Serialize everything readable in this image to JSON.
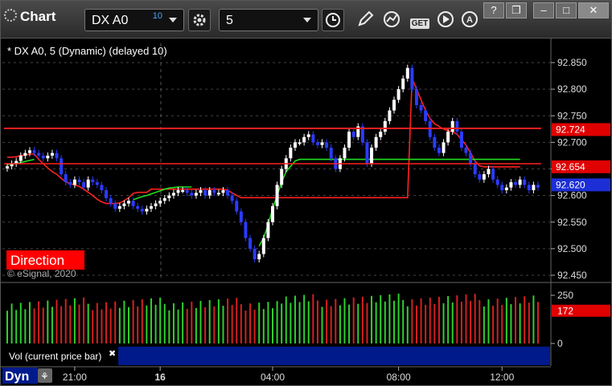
{
  "window": {
    "title": "Chart"
  },
  "toolbar": {
    "symbol": "DX A0",
    "symbol_delay": "10",
    "interval": "5",
    "get_label": "GET",
    "win_help": "?",
    "win_restore": "❐",
    "win_min": "–",
    "win_max": "□",
    "win_close": "✕"
  },
  "chart_header": "* DX A0, 5 (Dynamic) (delayed 10)",
  "direction_label": "Direction",
  "copyright": "© eSignal, 2020",
  "volume_label": "Vol (current price bar)",
  "volume_close": "✖",
  "bottom": {
    "scroll_label": "Dyn"
  },
  "colors": {
    "up_bar": "#ffffff",
    "down_bar": "#2b3bff",
    "red_line": "#ff2020",
    "green_line": "#22dd22",
    "price_tag_blue": "#1c2fd6"
  },
  "chart_data": [
    {
      "type": "candlestick",
      "ylim": [
        92.44,
        92.87
      ],
      "ytick_labels": [
        "92.850",
        "92.800",
        "92.750",
        "92.700",
        "92.650",
        "92.600",
        "92.550",
        "92.500",
        "92.450"
      ],
      "yticks": [
        92.85,
        92.8,
        92.75,
        92.7,
        92.65,
        92.6,
        92.55,
        92.5,
        92.45
      ],
      "xtick_labels": [
        "21:00",
        "16",
        "04:00",
        "08:00",
        "12:00"
      ],
      "xtick_index": [
        15,
        34,
        59,
        87,
        110
      ],
      "price_tags": [
        {
          "label": "92.724",
          "value": 92.724,
          "kind": "red"
        },
        {
          "label": "92.654",
          "value": 92.654,
          "kind": "red"
        },
        {
          "label": "92.620",
          "value": 92.62,
          "kind": "blue"
        }
      ],
      "close": [
        92.655,
        92.66,
        92.665,
        92.675,
        92.68,
        92.685,
        92.68,
        92.675,
        92.67,
        92.675,
        92.68,
        92.67,
        92.64,
        92.625,
        92.62,
        92.63,
        92.625,
        92.615,
        92.63,
        92.625,
        92.62,
        92.61,
        92.595,
        92.585,
        92.575,
        92.58,
        92.585,
        92.59,
        92.58,
        92.575,
        92.57,
        92.575,
        92.58,
        92.585,
        92.59,
        92.595,
        92.6,
        92.605,
        92.61,
        92.61,
        92.605,
        92.6,
        92.605,
        92.61,
        92.6,
        92.61,
        92.605,
        92.605,
        92.61,
        92.6,
        92.59,
        92.57,
        92.55,
        92.52,
        92.5,
        92.48,
        92.49,
        92.52,
        92.55,
        92.58,
        92.62,
        92.65,
        92.67,
        92.69,
        92.7,
        92.7,
        92.71,
        92.715,
        92.7,
        92.695,
        92.7,
        92.69,
        92.67,
        92.65,
        92.67,
        92.69,
        92.72,
        92.71,
        92.73,
        92.7,
        92.66,
        92.69,
        92.71,
        92.72,
        92.74,
        92.76,
        92.78,
        92.8,
        92.82,
        92.84,
        92.8,
        92.77,
        92.76,
        92.74,
        92.71,
        92.69,
        92.68,
        92.7,
        92.72,
        92.74,
        92.72,
        92.69,
        92.68,
        92.66,
        92.64,
        92.63,
        92.64,
        92.65,
        92.63,
        92.62,
        92.61,
        92.615,
        92.625,
        92.62,
        92.63,
        92.62,
        92.61,
        92.62,
        92.615
      ],
      "red_line": [
        92.672,
        92.672,
        92.673,
        92.675,
        92.676,
        92.678,
        92.678,
        92.668,
        92.66,
        92.652,
        92.645,
        92.64,
        92.632,
        92.626,
        92.622,
        92.62,
        92.617,
        92.612,
        92.606,
        92.6,
        92.593,
        92.588,
        92.585,
        92.585,
        92.585,
        92.586,
        92.59,
        92.596,
        92.604,
        92.606,
        92.606,
        92.606,
        92.612,
        92.612,
        92.612,
        92.612,
        92.612,
        92.612,
        92.612,
        92.612,
        92.612,
        92.612,
        92.612,
        92.612,
        92.612,
        92.612,
        92.612,
        92.612,
        92.612,
        92.61,
        92.605,
        92.6,
        92.596,
        92.596,
        92.596,
        92.596,
        92.596,
        92.596,
        92.596,
        92.596,
        92.596,
        92.596,
        92.596,
        92.596,
        92.596,
        92.596,
        92.596,
        92.596,
        92.596,
        92.596,
        92.596,
        92.596,
        92.596,
        92.596,
        92.596,
        92.596,
        92.596,
        92.596,
        92.596,
        92.596,
        92.596,
        92.596,
        92.596,
        92.596,
        92.596,
        92.596,
        92.596,
        92.596,
        92.596,
        92.596,
        92.82,
        92.8,
        92.78,
        92.76,
        92.745,
        92.735,
        92.73,
        92.725,
        92.722,
        92.72,
        92.715,
        92.705,
        92.695,
        92.68,
        92.665,
        92.656,
        92.654,
        92.654,
        92.654,
        92.654,
        92.654,
        92.654,
        92.654,
        92.654,
        92.654
      ],
      "green_line": [
        92.658,
        92.66,
        92.66,
        92.662,
        92.664,
        92.666,
        92.668,
        null,
        null,
        null,
        null,
        null,
        null,
        null,
        null,
        null,
        null,
        null,
        null,
        null,
        null,
        null,
        null,
        null,
        null,
        null,
        null,
        null,
        92.592,
        92.595,
        92.598,
        92.6,
        92.603,
        92.606,
        92.609,
        92.612,
        92.614,
        92.615,
        92.616,
        92.616,
        92.616,
        92.616,
        null,
        null,
        null,
        null,
        null,
        null,
        null,
        null,
        null,
        null,
        null,
        null,
        null,
        null,
        92.505,
        92.52,
        92.545,
        92.575,
        92.6,
        92.625,
        92.645,
        92.655,
        92.665,
        92.668,
        92.668,
        92.668,
        92.668,
        92.668,
        92.668,
        92.668,
        92.668,
        92.668,
        92.668,
        92.668,
        92.668,
        92.668,
        92.668,
        92.668,
        92.668,
        92.668,
        92.668,
        92.668,
        92.668,
        92.668,
        92.668,
        92.668,
        92.668,
        92.668,
        92.668,
        92.668,
        92.668,
        92.668,
        92.668,
        92.668,
        92.668,
        92.668,
        92.668,
        92.668,
        92.668,
        92.668,
        92.668,
        92.668,
        92.668,
        92.668,
        92.668,
        92.668,
        92.668,
        92.668,
        92.668,
        92.668,
        92.668,
        92.668,
        92.668
      ]
    },
    {
      "type": "bar",
      "title": "Vol (current price bar)",
      "ylim": [
        0,
        300
      ],
      "ytick_labels": [
        "250",
        "0"
      ],
      "yticks": [
        250,
        0
      ],
      "price_tag": {
        "label": "172",
        "value": 172
      }
    }
  ]
}
